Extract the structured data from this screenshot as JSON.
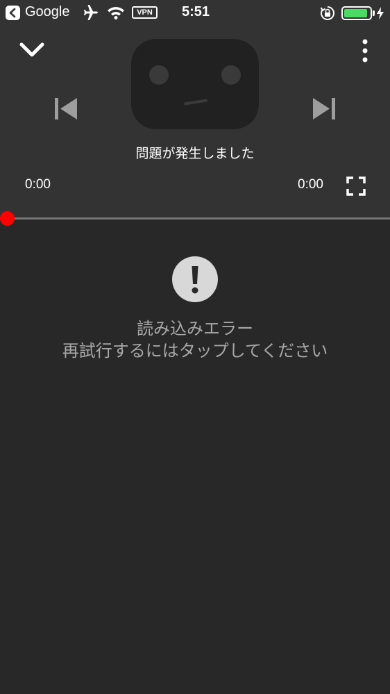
{
  "status_bar": {
    "back_app": "Google",
    "vpn": "VPN",
    "time": "5:51",
    "battery_level": 0.92,
    "battery_color": "#4cd964"
  },
  "player": {
    "error_message": "問題が発生しました",
    "current_time": "0:00",
    "total_time": "0:00",
    "progress": 0,
    "accent_color": "#ff0000",
    "icons": [
      "chevron-down-icon",
      "more-vert-icon",
      "skip-previous-icon",
      "skip-next-icon",
      "fullscreen-icon"
    ]
  },
  "load_error": {
    "title": "読み込みエラー",
    "hint": "再試行するにはタップしてください",
    "icon": "alert-icon"
  }
}
